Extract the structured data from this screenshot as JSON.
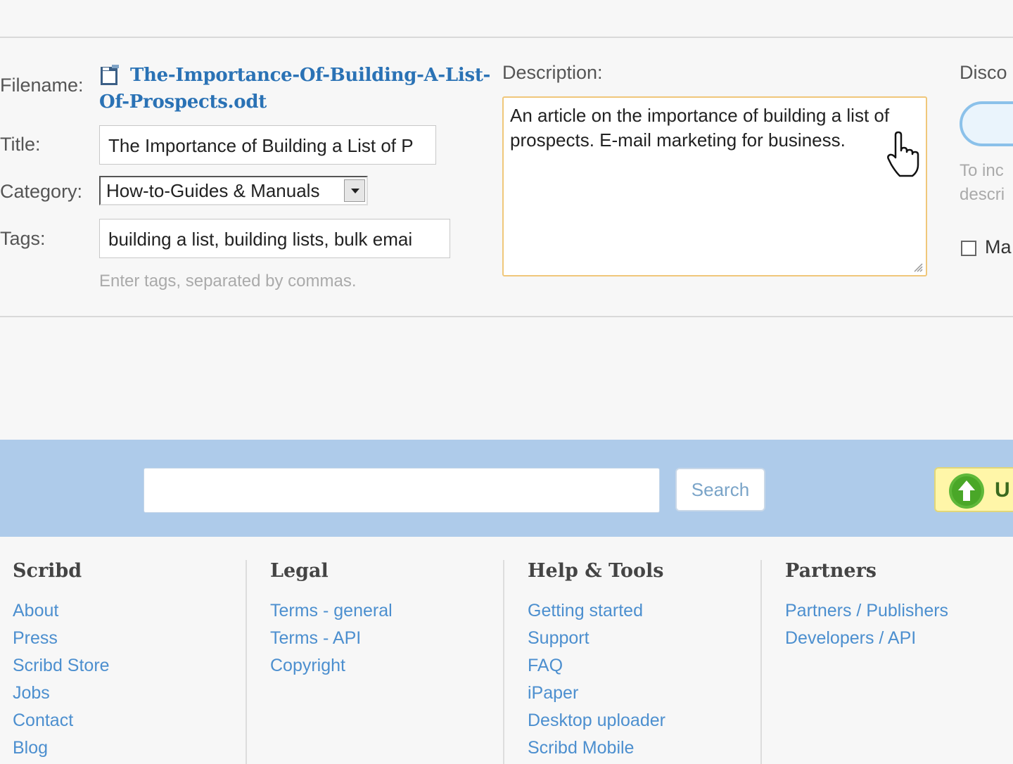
{
  "form": {
    "filename_label": "Filename:",
    "filename": "The-Importance-Of-Building-A-List-Of-Prospects.odt",
    "title_label": "Title:",
    "title_value": "The Importance of Building a List of P",
    "category_label": "Category:",
    "category_value": "How-to-Guides & Manuals",
    "tags_label": "Tags:",
    "tags_value": "building a list, building lists, bulk emai",
    "tags_hint": "Enter tags, separated by commas.",
    "description_label": "Description:",
    "description_value": "An article on the importance of building a list of prospects.  E-mail marketing for business."
  },
  "sidebar": {
    "heading": "Disco",
    "note": "To inc descri",
    "checkbox_label": "Ma"
  },
  "search": {
    "button_label": "Search",
    "upload_label": "U"
  },
  "footer": {
    "columns": [
      {
        "heading": "Scribd",
        "links": [
          "About",
          "Press",
          "Scribd Store",
          "Jobs",
          "Contact",
          "Blog"
        ]
      },
      {
        "heading": "Legal",
        "links": [
          "Terms - general",
          "Terms - API",
          "Copyright"
        ]
      },
      {
        "heading": "Help & Tools",
        "links": [
          "Getting started",
          "Support",
          "FAQ",
          "iPaper",
          "Desktop uploader",
          "Scribd Mobile"
        ]
      },
      {
        "heading": "Partners",
        "links": [
          "Partners / Publishers",
          "Developers / API"
        ]
      }
    ]
  },
  "colors": {
    "link": "#2a72b5",
    "search_band": "#aecbea",
    "description_focus_border": "#f0c77a",
    "upload_button": "#fff6a8"
  },
  "icons": [
    "document-icon",
    "dropdown-arrow-icon",
    "resize-grip-icon",
    "hand-cursor-icon",
    "upload-arrow-icon"
  ]
}
